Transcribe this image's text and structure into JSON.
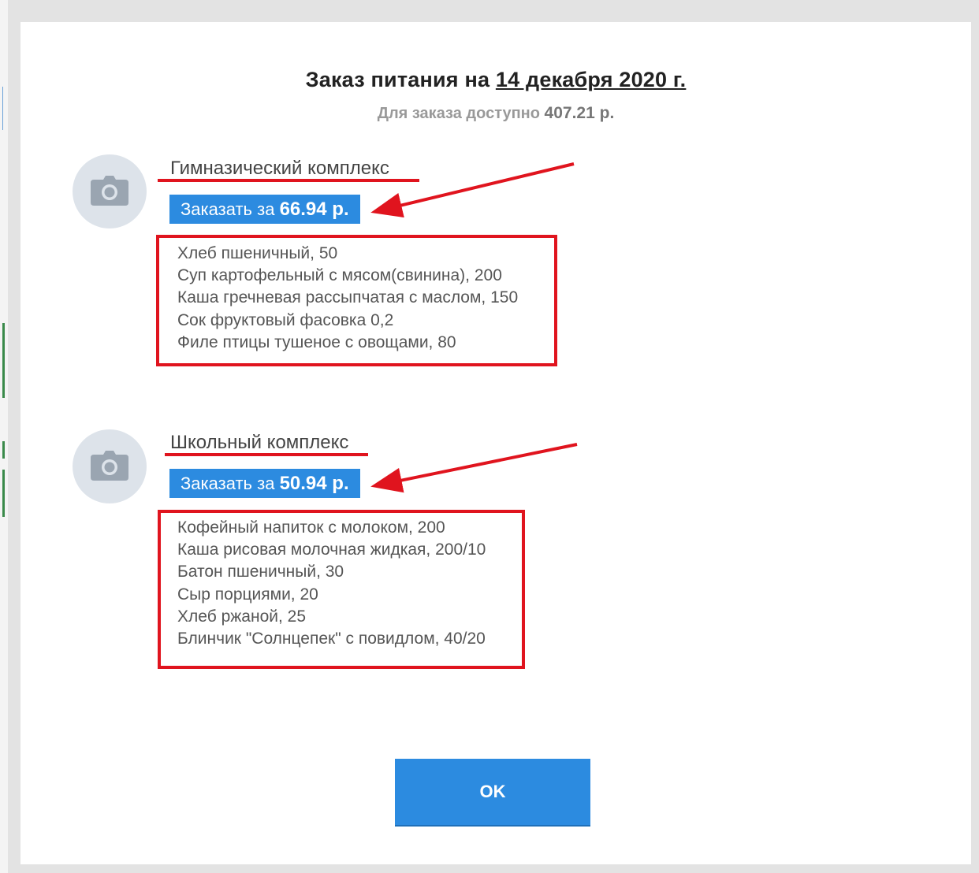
{
  "dialog": {
    "title_prefix": "Заказ питания на",
    "title_date": "14 декабря 2020 г.",
    "available_prefix": "Для заказа доступно",
    "available_amount": "407.21 р.",
    "ok_label": "OK"
  },
  "complexes": [
    {
      "name": "Гимназический комплекс",
      "button_prefix": "Заказать за",
      "button_price": "66.94 р.",
      "items": [
        "Хлеб пшеничный, 50",
        "Суп картофельный с мясом(свинина), 200",
        "Каша гречневая рассыпчатая с маслом, 150",
        "Сок фруктовый фасовка 0,2",
        "Филе птицы тушеное с овощами, 80"
      ]
    },
    {
      "name": "Школьный комплекс",
      "button_prefix": "Заказать за",
      "button_price": "50.94 р.",
      "items": [
        "Кофейный напиток с молоком, 200",
        "Каша рисовая молочная жидкая, 200/10",
        "Батон пшеничный, 30",
        "Сыр порциями, 20",
        "Хлеб ржаной, 25",
        "Блинчик \"Солнцепек\" с повидлом, 40/20"
      ]
    }
  ],
  "colors": {
    "button_blue": "#2c8be0",
    "annotation_red": "#e0141e",
    "avatar_bg": "#dde3ea"
  },
  "icons": [
    "camera-icon"
  ]
}
